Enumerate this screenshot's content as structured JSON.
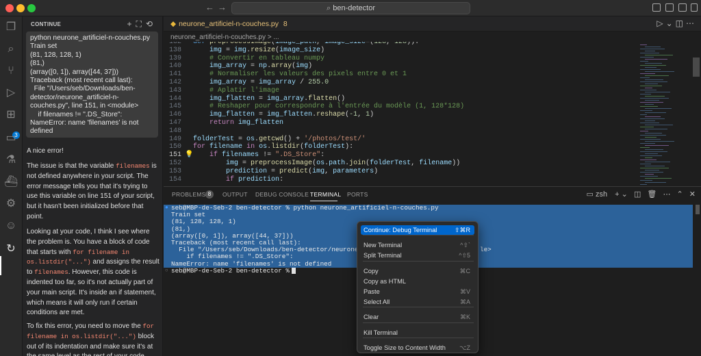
{
  "window": {
    "title": "ben-detector"
  },
  "chat": {
    "header": "CONTINUE",
    "error_output": "python neurone_artificiel-n-couches.py\nTrain set\n(81, 128, 128, 1)\n(81,)\n(array([0, 1]), array([44, 37]))\nTraceback (most recent call last):\n  File \"/Users/seb/Downloads/ben-\ndetector/neurone_artificiel-n-\ncouches.py\", line 151, in <module>\n    if filenames != \".DS_Store\":\nNameError: name 'filenames' is not\ndefined",
    "p1": "A nice error!",
    "p2_a": "The issue is that the variable ",
    "p2_code": "filenames",
    "p2_b": " is not defined anywhere in your script. The error message tells you that it's trying to use this variable on line 151 of your script, but it hasn't been initialized before that point.",
    "p3_a": "Looking at your code, I think I see where the problem is. You have a block of code that starts with ",
    "p3_code1": "for filename in os.listdir(\"...\")",
    "p3_b": " and assigns the result to ",
    "p3_code2": "filenames",
    "p3_c": ". However, this code is indented too far, so it's not actually part of your main script. It's inside an if statement, which means it will only run if certain conditions are met.",
    "p4_a": "To fix this error, you need to move the ",
    "p4_code": "for filename in os.listdir(\"...\")",
    "p4_b": " block out of its indentation and make sure it's at the same level as the rest of your code. This"
  },
  "editor": {
    "tab_label": "neurone_artificiel-n-couches.py",
    "tab_badge": "8",
    "breadcrumb": "neurone_artificiel-n-couches.py > ...",
    "lines": [
      {
        "n": "132",
        "html": "<span class='kw'>def</span> <span class='fn'>preprocessImage</span>(<span class='var'>image_path</span>, <span class='var'>image_size</span>=(<span class='num'>128</span>, <span class='num'>128</span>)):"
      },
      {
        "n": "138",
        "html": "    <span class='var'>img</span> = <span class='var'>img</span>.<span class='fn'>resize</span>(<span class='var'>image_size</span>)"
      },
      {
        "n": "139",
        "html": "    <span class='cm'># Convertir en tableau numpy</span>"
      },
      {
        "n": "140",
        "html": "    <span class='var'>img_array</span> = <span class='var'>np</span>.<span class='fn'>array</span>(<span class='var'>img</span>)"
      },
      {
        "n": "141",
        "html": "    <span class='cm'># Normaliser les valeurs des pixels entre 0 et 1</span>"
      },
      {
        "n": "142",
        "html": "    <span class='var'>img_array</span> = <span class='var'>img_array</span> / <span class='num'>255.0</span>"
      },
      {
        "n": "143",
        "html": "    <span class='cm'># Aplatir l'image</span>"
      },
      {
        "n": "144",
        "html": "    <span class='var'>img_flatten</span> = <span class='var'>img_array</span>.<span class='fn'>flatten</span>()"
      },
      {
        "n": "145",
        "html": "    <span class='cm'># Reshaper pour correspondre à l'entrée du modèle (1, 128*128)</span>"
      },
      {
        "n": "146",
        "html": "    <span class='var'>img_flatten</span> = <span class='var'>img_flatten</span>.<span class='fn'>reshape</span>(<span class='num'>-1</span>, <span class='num'>1</span>)"
      },
      {
        "n": "147",
        "html": "    <span class='ctrl'>return</span> <span class='var'>img_flatten</span>"
      },
      {
        "n": "148",
        "html": ""
      },
      {
        "n": "149",
        "html": "<span class='var'>folderTest</span> = <span class='var'>os</span>.<span class='fn'>getcwd</span>() + <span class='str'>'/photos/test/'</span>"
      },
      {
        "n": "150",
        "html": "<span class='ctrl'>for</span> <span class='var'>filename</span> <span class='ctrl'>in</span> <span class='var'>os</span>.<span class='fn'>listdir</span>(<span class='var'>folderTest</span>):"
      },
      {
        "n": "151",
        "html": "    <span class='ctrl'>if</span> <span class='var'>filenames</span> != <span class='str'>\".DS_Store\"</span>:"
      },
      {
        "n": "152",
        "html": "        <span class='var'>img</span> = <span class='fn'>preprocessImage</span>(<span class='var'>os</span>.<span class='var'>path</span>.<span class='fn'>join</span>(<span class='var'>folderTest</span>, <span class='var'>filename</span>))"
      },
      {
        "n": "153",
        "html": "        <span class='var'>prediction</span> = <span class='fn'>predict</span>(<span class='var'>img</span>, <span class='var'>parameters</span>)"
      },
      {
        "n": "154",
        "html": "        <span class='ctrl'>if</span> <span class='var'>prediction</span>:"
      }
    ]
  },
  "panel": {
    "tabs": [
      "PROBLEMS",
      "OUTPUT",
      "DEBUG CONSOLE",
      "TERMINAL",
      "PORTS"
    ],
    "problems_count": "8",
    "shell_label": "zsh",
    "terminal_lines": [
      "seb@MBP-de-Seb-2 ben-detector % python neurone_artificiel-n-couches.py",
      "Train set",
      "(81, 128, 128, 1)",
      "(81,)",
      "(array([0, 1]), array([44, 37]))",
      "Traceback (most recent call last):",
      "  File \"/Users/seb/Downloads/ben-detector/neurone_artific",
      "    if filenames != \".DS_Store\":",
      "NameError: name 'filenames' is not defined",
      "seb@MBP-de-Seb-2 ben-detector %"
    ],
    "terminal_line7_tail": "le>"
  },
  "context_menu": {
    "items": [
      {
        "label": "Continue: Debug Terminal",
        "shortcut": "⇧⌘R"
      },
      {
        "label": "New Terminal",
        "shortcut": "^⇧`"
      },
      {
        "label": "Split Terminal",
        "shortcut": "^⇧5"
      },
      {
        "label": "Copy",
        "shortcut": "⌘C"
      },
      {
        "label": "Copy as HTML",
        "shortcut": ""
      },
      {
        "label": "Paste",
        "shortcut": "⌘V"
      },
      {
        "label": "Select All",
        "shortcut": "⌘A"
      },
      {
        "label": "Clear",
        "shortcut": "⌘K"
      },
      {
        "label": "Kill Terminal",
        "shortcut": ""
      },
      {
        "label": "Toggle Size to Content Width",
        "shortcut": "⌥Z"
      }
    ]
  },
  "colors": {
    "accent": "#0066cc",
    "selection": "#2f6fb0"
  }
}
